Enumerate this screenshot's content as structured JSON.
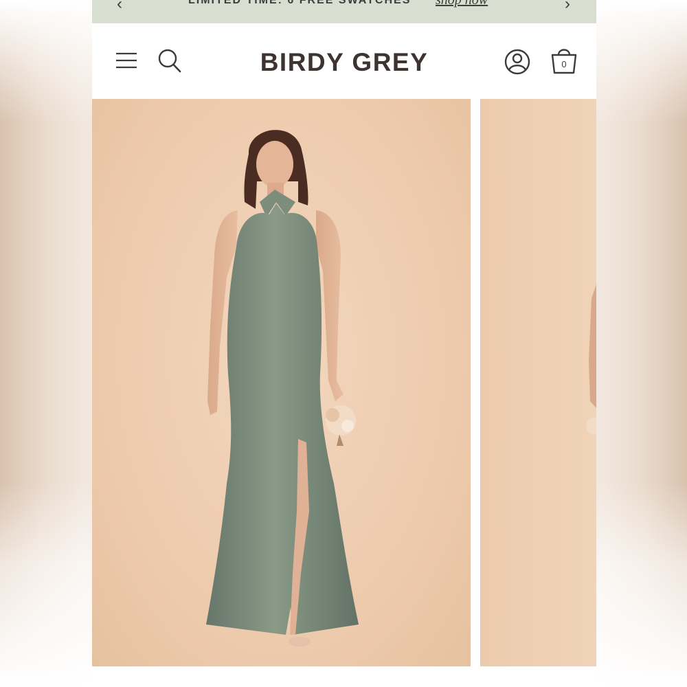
{
  "promo": {
    "prev_icon": "chevron-left-icon",
    "text": "LIMITED TIME: 6 FREE SWATCHES",
    "link": "shop now",
    "next_icon": "chevron-right-icon"
  },
  "header": {
    "menu_icon": "hamburger-menu-icon",
    "search_icon": "search-icon",
    "logo": "BIRDY GREY",
    "account_icon": "user-account-icon",
    "cart_icon": "shopping-bag-icon",
    "cart_count": "0"
  },
  "gallery": {
    "slides": [
      {
        "alt": "model wearing sage green satin halter maxi dress with front slit holding bouquet"
      },
      {
        "alt": "next product image partially visible"
      }
    ]
  },
  "colors": {
    "promo_bg": "#d8dfd0",
    "photo_bg": "#efcfb2",
    "dress": "#7a8a78",
    "logo": "#3d3331"
  }
}
